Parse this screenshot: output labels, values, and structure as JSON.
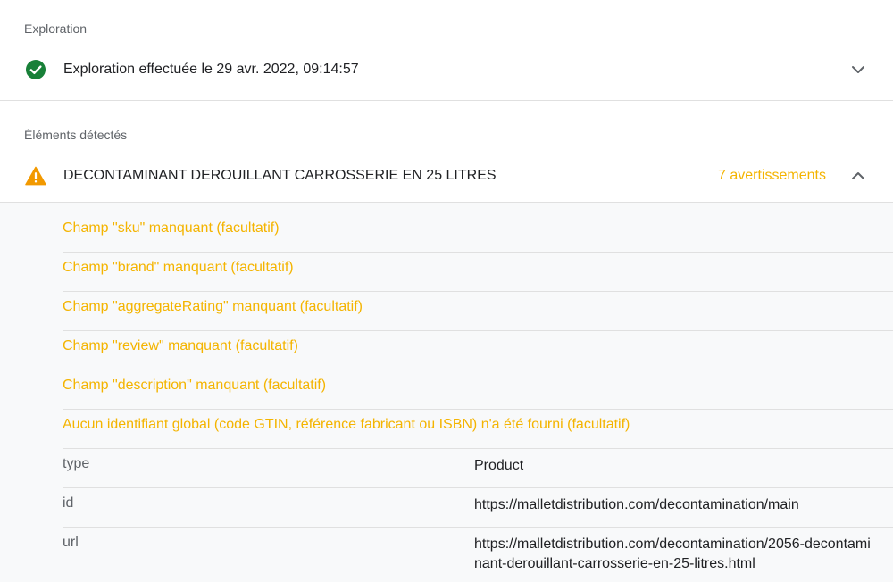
{
  "crawl_section": {
    "label": "Exploration",
    "status_text": "Exploration effectuée le 29 avr. 2022, 09:14:57",
    "status_color": "#188038"
  },
  "detected_section": {
    "label": "Éléments détectés",
    "item_title": "DECONTAMINANT DEROUILLANT CARROSSERIE EN 25 LITRES",
    "warning_count": "7 avertissements",
    "warning_color": "#f4b400",
    "warnings": [
      "Champ \"sku\" manquant (facultatif)",
      "Champ \"brand\" manquant (facultatif)",
      "Champ \"aggregateRating\" manquant (facultatif)",
      "Champ \"review\" manquant (facultatif)",
      "Champ \"description\" manquant (facultatif)",
      "Aucun identifiant global (code GTIN, référence fabricant ou ISBN) n'a été fourni (facultatif)"
    ],
    "properties": [
      {
        "key": "type",
        "value": "Product"
      },
      {
        "key": "id",
        "value": "https://malletdistribution.com/decontamination/main"
      },
      {
        "key": "url",
        "value": "https://malletdistribution.com/decontamination/2056-decontaminant-derouillant-carrosserie-en-25-litres.html"
      }
    ]
  },
  "icons": {
    "status": "check-circle-icon",
    "warning": "warning-triangle-icon",
    "expand": "chevron-down-icon",
    "collapse": "chevron-up-icon"
  }
}
